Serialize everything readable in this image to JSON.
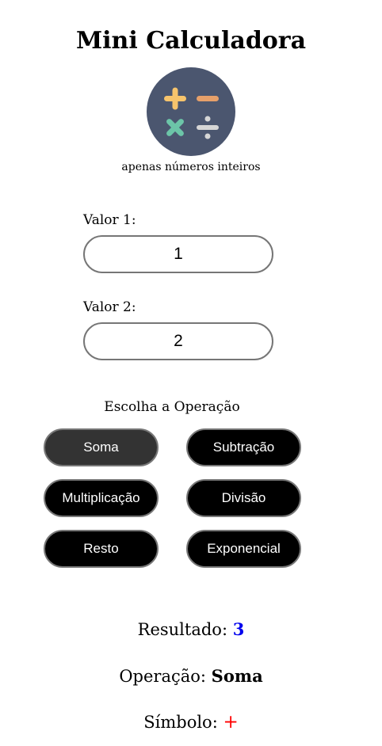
{
  "header": {
    "title": "Mini Calculadora",
    "subtitle": "apenas números inteiros"
  },
  "logo": {
    "icon": "math-operations-icon",
    "background_color": "#4b566f",
    "plus_color": "#f7c46c",
    "minus_color": "#e6a06a",
    "times_color": "#6cc5a8",
    "divide_color": "#d6d6d6"
  },
  "fields": {
    "value1": {
      "label": "Valor 1:",
      "value": "1"
    },
    "value2": {
      "label": "Valor 2:",
      "value": "2"
    }
  },
  "operations": {
    "title": "Escolha a Operação",
    "selected": "Soma",
    "buttons": [
      "Soma",
      "Subtração",
      "Multiplicação",
      "Divisão",
      "Resto",
      "Exponencial"
    ]
  },
  "result": {
    "label": "Resultado:",
    "value": "3",
    "operation_label": "Operação:",
    "operation_value": "Soma",
    "symbol_label": "Símbolo:",
    "symbol_value": "+",
    "value_color": "#0000ee",
    "symbol_color": "#ff0000"
  }
}
